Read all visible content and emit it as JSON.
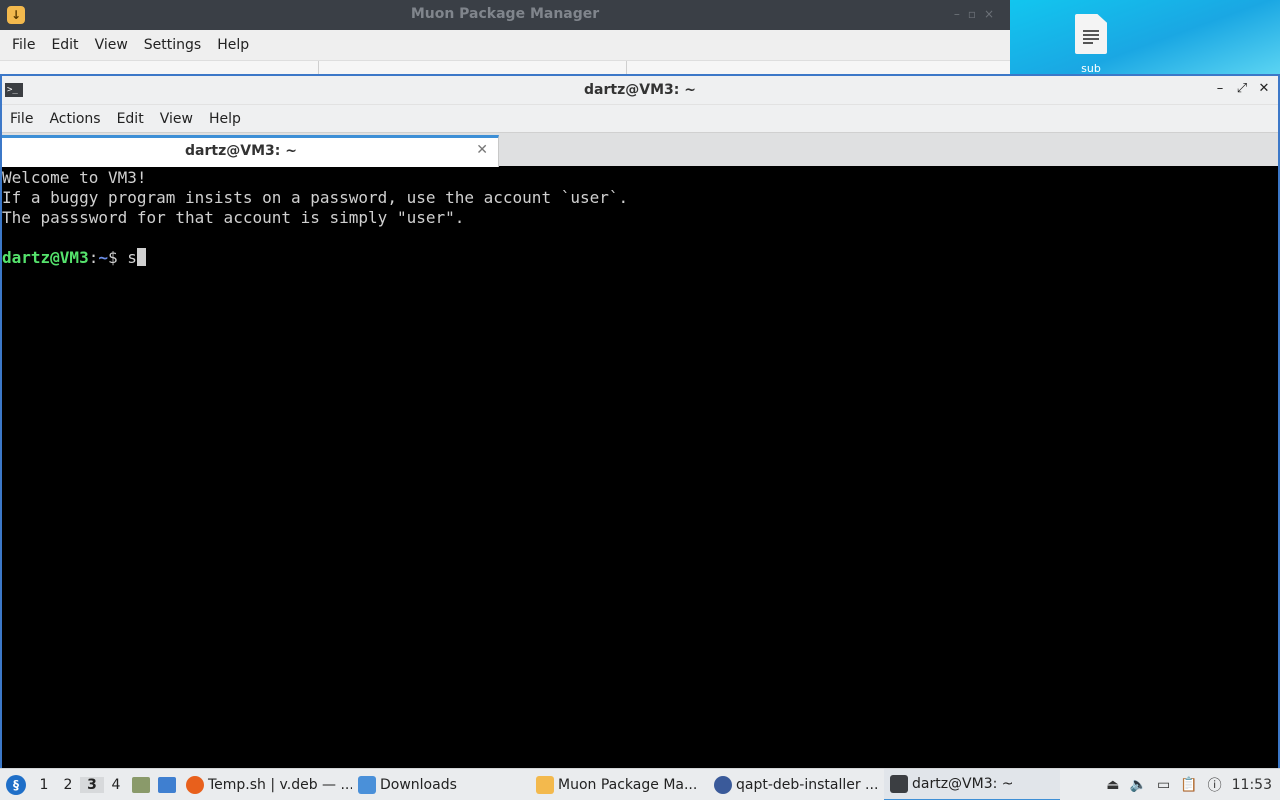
{
  "muon": {
    "title": "Muon Package Manager",
    "app_icon": "download-icon",
    "menu": [
      "File",
      "Edit",
      "View",
      "Settings",
      "Help"
    ]
  },
  "desktop": {
    "file_icon": "text-file-icon",
    "file_label": "sub"
  },
  "terminal": {
    "title": "dartz@VM3: ~",
    "menu": [
      "File",
      "Actions",
      "Edit",
      "View",
      "Help"
    ],
    "tab_label": "dartz@VM3: ~",
    "lines": [
      "Welcome to VM3!",
      "If a buggy program insists on a password, use the account `user`.",
      "The passsword for that account is simply \"user\"."
    ],
    "prompt_user": "dartz@VM3",
    "prompt_sep": ":",
    "prompt_path": "~",
    "prompt_symbol": "$ ",
    "typed": "s"
  },
  "taskbar": {
    "workspaces": [
      "1",
      "2",
      "3",
      "4"
    ],
    "active_workspace": "3",
    "tasks": [
      {
        "label": "Temp.sh | v.deb — ...",
        "icon": "firefox-icon",
        "color": "#e8601c"
      },
      {
        "label": "Downloads",
        "icon": "folder-icon",
        "color": "#4a90d9"
      },
      {
        "label": "Muon Package Ma...",
        "icon": "muon-icon",
        "color": "#f3b94d"
      },
      {
        "label": "qapt-deb-installer ...",
        "icon": "installer-icon",
        "color": "#3a5a9a"
      },
      {
        "label": "dartz@VM3: ~",
        "icon": "terminal-icon",
        "color": "#3b3e42"
      }
    ],
    "clock": "11:53"
  }
}
